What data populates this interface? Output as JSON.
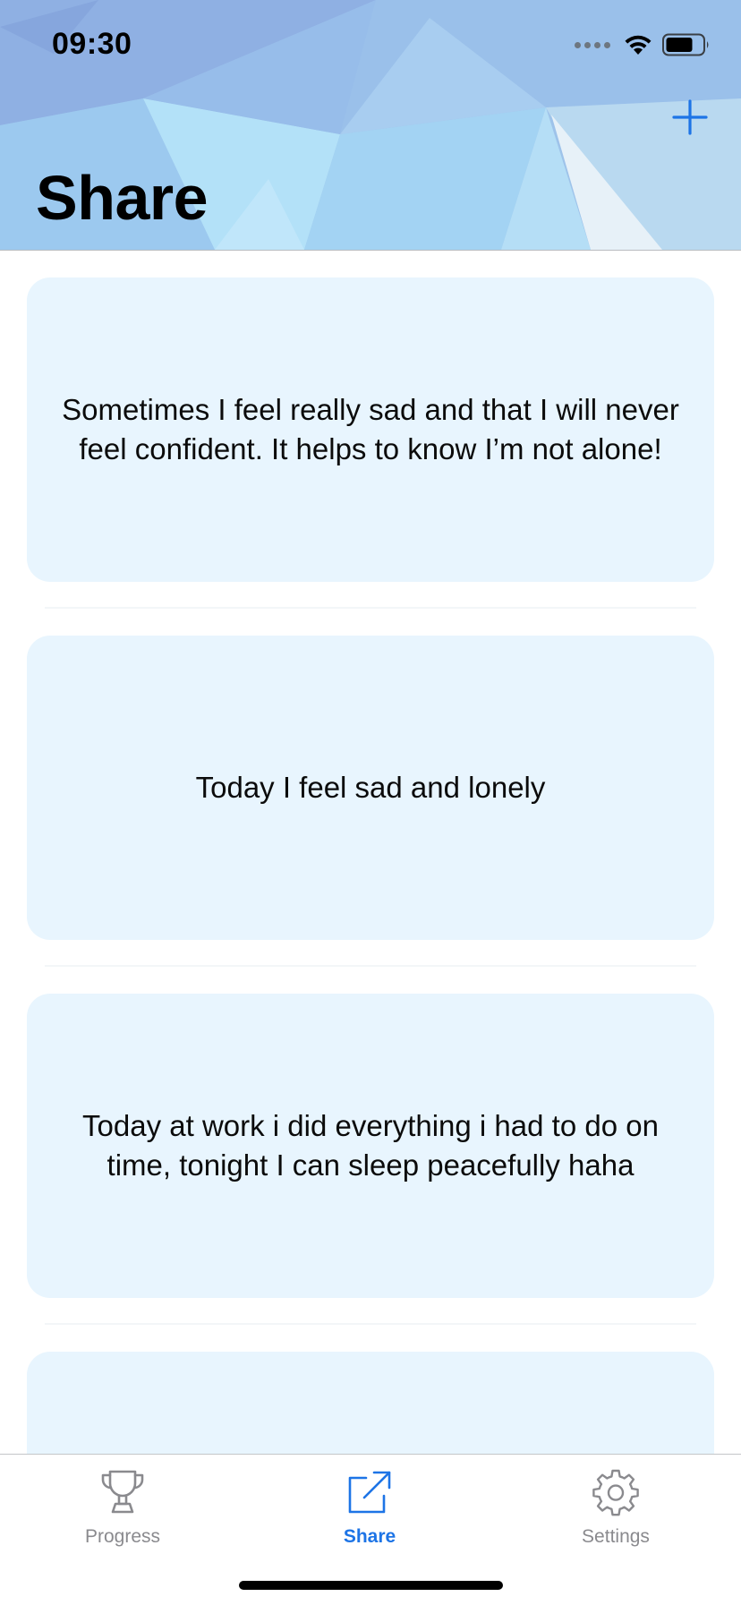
{
  "status_bar": {
    "time": "09:30"
  },
  "header": {
    "title": "Share",
    "add_icon": "plus-icon"
  },
  "posts": [
    {
      "text": "Sometimes I feel really sad and that I will never feel confident. It helps to know I’m not alone!"
    },
    {
      "text": "Today I feel sad and lonely"
    },
    {
      "text": "Today at work i did everything i had to do on time, tonight I can sleep peacefully haha"
    },
    {
      "text": ""
    }
  ],
  "tab_bar": {
    "tabs": [
      {
        "label": "Progress",
        "icon": "trophy-icon",
        "active": false
      },
      {
        "label": "Share",
        "icon": "share-icon",
        "active": true
      },
      {
        "label": "Settings",
        "icon": "gear-icon",
        "active": false
      }
    ]
  },
  "colors": {
    "accent": "#1d74e6",
    "card_background": "#e8f5fe",
    "inactive_tab": "#8a8a8e"
  }
}
